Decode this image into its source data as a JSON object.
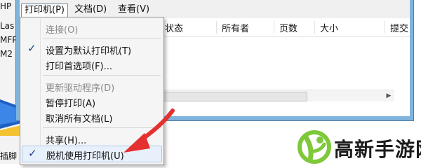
{
  "left_strip": {
    "lines": [
      "HP",
      "Las",
      "MFP",
      "M2",
      "插脚"
    ]
  },
  "menubar": {
    "items": [
      "打印机(P)",
      "文档(D)",
      "查看(V)"
    ]
  },
  "columns": [
    "状态",
    "所有者",
    "页数",
    "大小",
    "提交"
  ],
  "dropdown": {
    "items": [
      {
        "label": "连接(O)",
        "disabled": true,
        "checked": false
      },
      {
        "label": "设置为默认打印机(T)",
        "disabled": false,
        "checked": true
      },
      {
        "label": "打印首选项(F)...",
        "disabled": false,
        "checked": false
      },
      {
        "label": "更新驱动程序(D)",
        "disabled": true,
        "checked": false
      },
      {
        "label": "暂停打印(A)",
        "disabled": false,
        "checked": false
      },
      {
        "label": "取消所有文档(L)",
        "disabled": false,
        "checked": false
      },
      {
        "label": "共享(H)...",
        "disabled": false,
        "checked": false
      },
      {
        "label": "脱机使用打印机(U)",
        "disabled": false,
        "checked": true
      }
    ]
  },
  "brand": {
    "name": "高新手游网"
  },
  "colors": {
    "accent_red": "#e53030",
    "logo_green": "#7ec83a",
    "window_frame": "#7fb5dd"
  }
}
